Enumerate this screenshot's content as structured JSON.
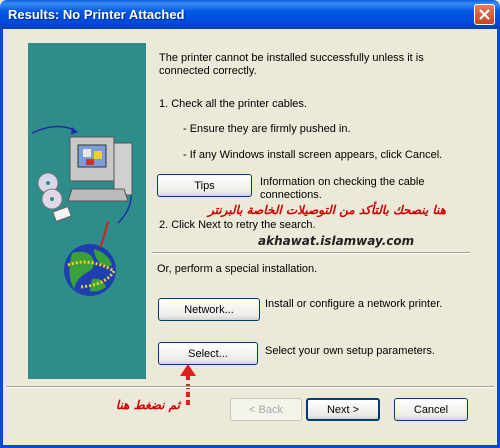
{
  "window": {
    "title": "Results: No Printer Attached"
  },
  "content": {
    "intro": "The printer cannot be installed successfully unless it is connected correctly.",
    "step1": "1. Check all the printer cables.",
    "bullet1": "- Ensure they are firmly pushed in.",
    "bullet2": "- If any Windows install screen appears, click Cancel.",
    "tips_label": "Tips",
    "tips_desc": "Information on checking the cable connections.",
    "step2": "2. Click Next to retry the search.",
    "special": "Or, perform a special installation.",
    "network_label": "Network...",
    "network_desc": "Install or configure a network printer.",
    "select_label": "Select...",
    "select_desc": "Select your own setup parameters."
  },
  "annotations": {
    "arabic_top": "هنا ينصحك بالتأكد من التوصيلات الخاصة بالبرنتر",
    "website": "akhawat.islamway.com",
    "arabic_bottom": "ثم نضغط هنا"
  },
  "footer": {
    "back_label": "< Back",
    "next_label": "Next >",
    "cancel_label": "Cancel"
  }
}
